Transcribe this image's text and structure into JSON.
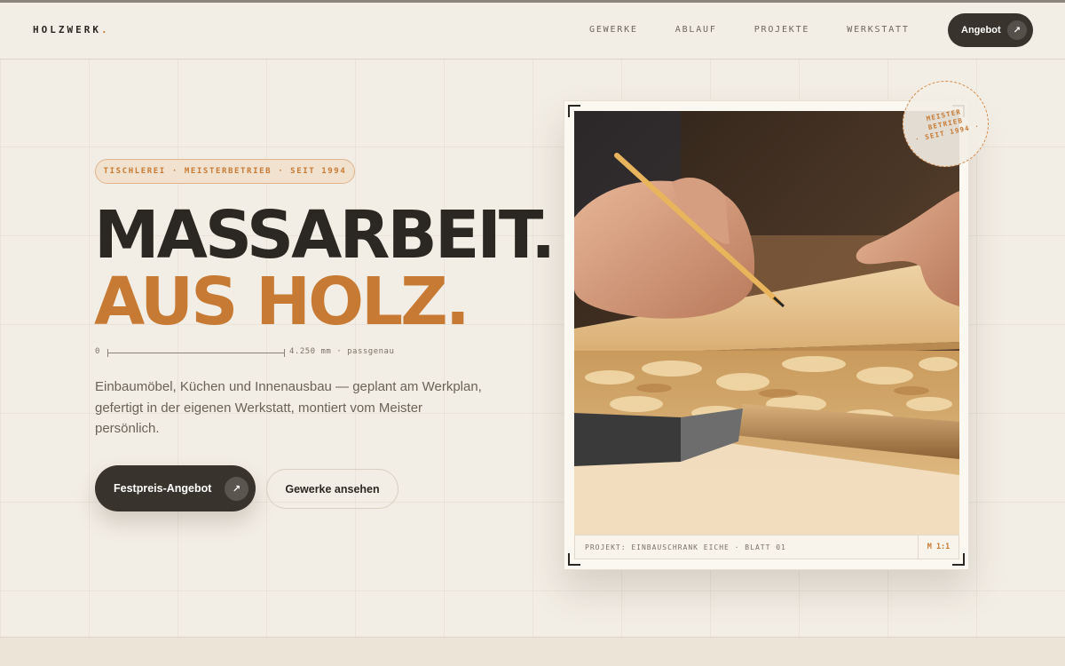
{
  "brand": {
    "name": "HOLZWERK",
    "dot": "."
  },
  "nav": {
    "items": [
      {
        "label": "GEWERKE"
      },
      {
        "label": "ABLAUF"
      },
      {
        "label": "PROJEKTE"
      },
      {
        "label": "WERKSTATT"
      }
    ],
    "cta_label": "Angebot",
    "cta_icon": "arrow-up-right-icon"
  },
  "hero": {
    "badge": "TISCHLEREI · MEISTERBETRIEB · SEIT 1994",
    "headline_line1": "MASSARBEIT.",
    "headline_line2": "AUS HOLZ.",
    "ruler": {
      "start": "0",
      "measure": "4.250 mm · passgenau"
    },
    "lead": "Einbaumöbel, Küchen und Innenausbau — geplant am Werkplan, gefertigt in der eigenen Werkstatt, montiert vom Meister persönlich.",
    "primary_button": "Festpreis-Angebot",
    "secondary_button": "Gewerke ansehen"
  },
  "project_card": {
    "caption": "PROJEKT: EINBAUSCHRANK EICHE · BLATT 01",
    "scale": "M 1:1"
  },
  "stamp": {
    "line1": "MEISTER",
    "line2": "BETRIEB",
    "line3": "· SEIT 1994 ·"
  },
  "colors": {
    "accent": "#c77a33",
    "ink": "#2b2823",
    "background": "#f3eee5",
    "button_dark": "#38342d"
  }
}
